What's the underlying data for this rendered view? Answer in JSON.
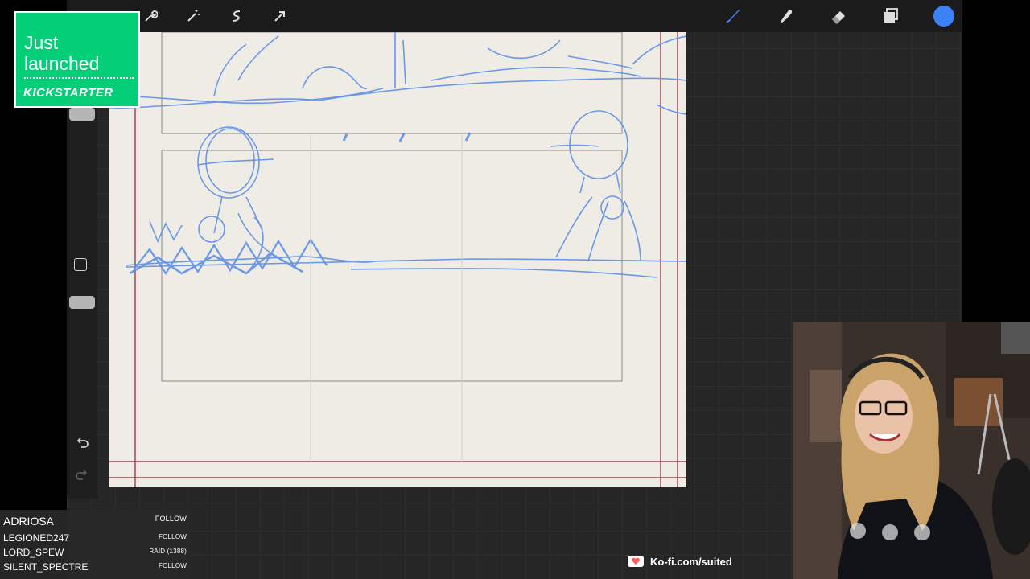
{
  "app": {
    "toolbar_left": [
      "wrench-icon",
      "magic-wand-icon",
      "selection-icon",
      "transform-arrow-icon"
    ],
    "toolbar_right": [
      "brush-icon",
      "smudge-icon",
      "eraser-icon",
      "layers-icon",
      "color-swatch-icon"
    ],
    "active_color": "#3b82f6",
    "sidebar": [
      "brush-size-slider",
      "modify-square-button",
      "opacity-slider",
      "undo-icon",
      "redo-icon"
    ]
  },
  "kickstarter": {
    "line1": "Just",
    "line2": "launched",
    "brand": "KICKSTARTER"
  },
  "chat": {
    "rows": [
      {
        "name": "ADRIOSA",
        "action": "FOLLOW"
      },
      {
        "name": "LEGIONED247",
        "action": "FOLLOW"
      },
      {
        "name": "LORD_SPEW",
        "action": "RAID (1388)"
      },
      {
        "name": "SILENT_SPECTRE",
        "action": "FOLLOW"
      }
    ]
  },
  "kofi": {
    "text": "Ko-fi.com/suited"
  },
  "colors": {
    "kickstarter_green": "#05ce78",
    "sketch_blue": "#5d8fe6",
    "border_red": "#8a2234"
  }
}
